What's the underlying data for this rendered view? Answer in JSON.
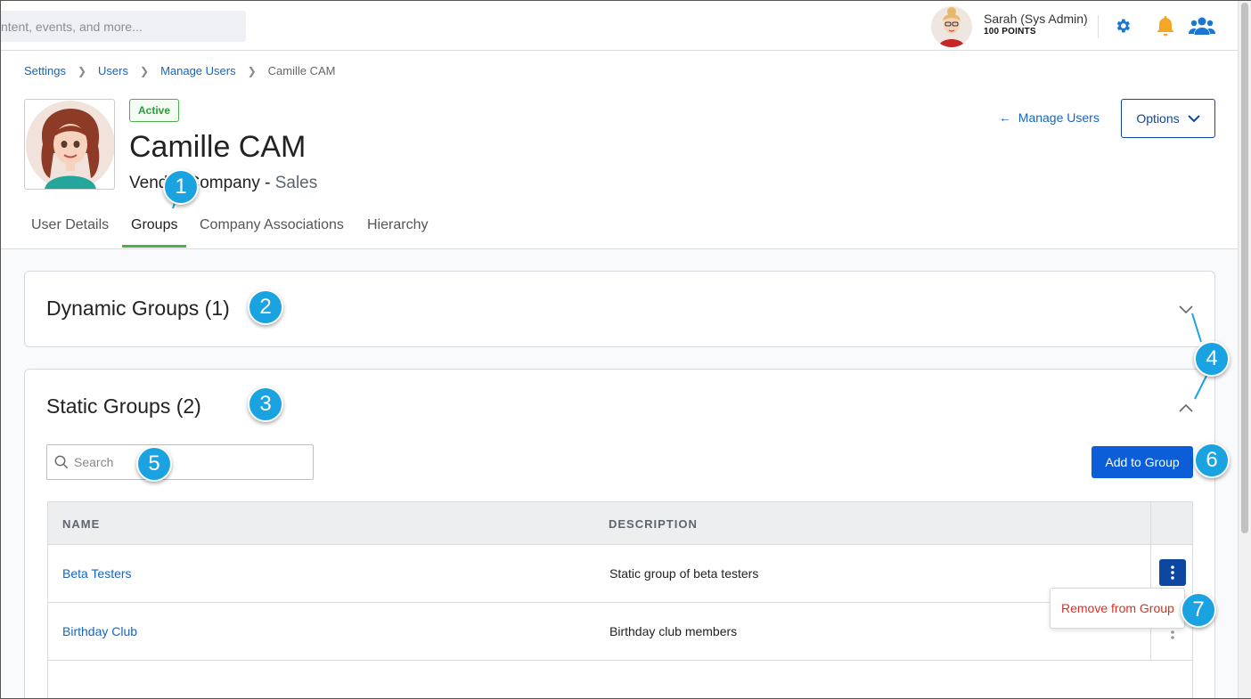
{
  "topbar": {
    "search_placeholder": "ntent, events, and more...",
    "user_name": "Sarah (Sys Admin)",
    "user_points": "100 POINTS"
  },
  "icons": {
    "settings": "gear-icon",
    "notifications": "bell-icon",
    "people": "users-icon"
  },
  "colors": {
    "link": "#1565c0",
    "primary": "#0b5ed7",
    "active_green": "#4caf50",
    "danger": "#d93025",
    "callout": "#1aa3e0",
    "gear": "#1976d2",
    "bell": "#f5a623"
  },
  "breadcrumb": {
    "items": [
      "Settings",
      "Users",
      "Manage Users"
    ],
    "current": "Camille CAM"
  },
  "profile": {
    "status": "Active",
    "name": "Camille CAM",
    "company": "Vendor Company - ",
    "department": "Sales",
    "back_link": "Manage Users",
    "options_label": "Options"
  },
  "tabs": [
    "User Details",
    "Groups",
    "Company Associations",
    "Hierarchy"
  ],
  "active_tab": "Groups",
  "dynamic_groups": {
    "title": "Dynamic Groups (1)"
  },
  "static_groups": {
    "title": "Static Groups (2)",
    "search_placeholder": "Search",
    "add_button": "Add to Group",
    "columns": [
      "NAME",
      "DESCRIPTION"
    ],
    "rows": [
      {
        "name": "Beta Testers",
        "description": "Static group of beta testers"
      },
      {
        "name": "Birthday Club",
        "description": "Birthday club members"
      }
    ],
    "row_menu": [
      "Remove from Group"
    ]
  },
  "callouts": [
    "1",
    "2",
    "3",
    "4",
    "5",
    "6",
    "7"
  ]
}
